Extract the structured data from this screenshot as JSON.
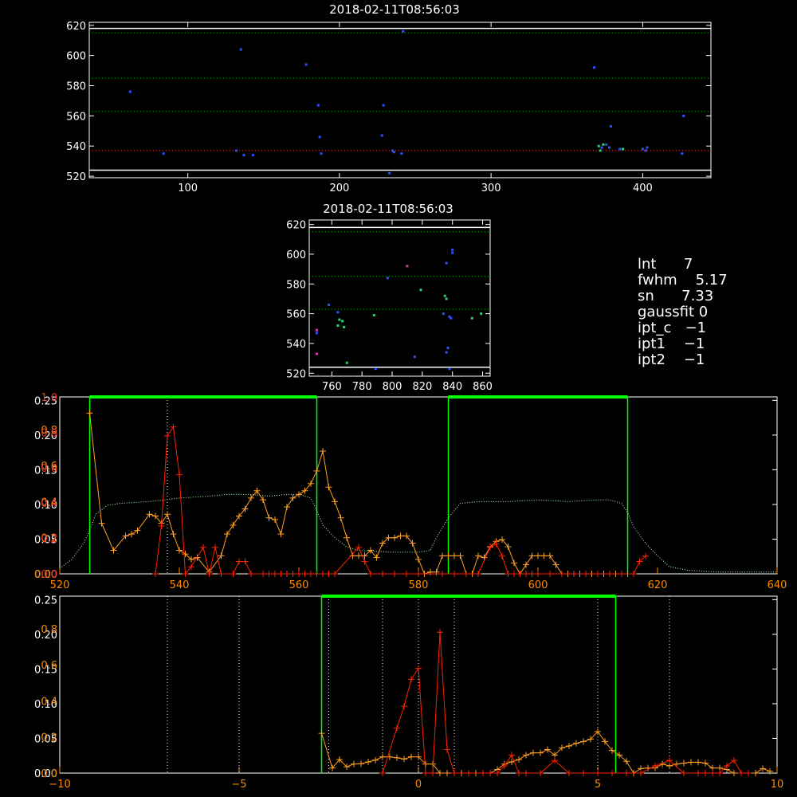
{
  "colors": {
    "axis_white": "#ffffff",
    "axis_orange": "#ff8c00",
    "axis_red": "#ff3020",
    "green": "#00ff00",
    "dotted_green": "#00c000",
    "orange_series": "#ffa020",
    "red_series": "#ff2000",
    "blue_points": "#3050ff",
    "green_points": "#30d070"
  },
  "info": {
    "rows": [
      {
        "key": "lnt",
        "value": "7"
      },
      {
        "key": "fwhm",
        "value": "5.17"
      },
      {
        "key": "sn",
        "value": "7.33"
      },
      {
        "key": "gaussfit",
        "value": "0"
      },
      {
        "key": "ipt_c",
        "value": "−1"
      },
      {
        "key": "ipt1",
        "value": "−1"
      },
      {
        "key": "ipt2",
        "value": "−1"
      }
    ]
  },
  "chart_data": [
    {
      "id": "top",
      "type": "scatter",
      "title": "2018-02-11T08:56:03",
      "xlim": [
        35,
        445
      ],
      "ylim": [
        519,
        622
      ],
      "xticks": [
        100,
        200,
        300,
        400
      ],
      "yticks": [
        520,
        540,
        560,
        580,
        600,
        620
      ],
      "hlines_solid": [
        618,
        524
      ],
      "hlines_dotted": [
        615,
        585,
        563
      ],
      "hline_red": 537,
      "points_blue": [
        [
          62,
          576
        ],
        [
          84,
          535
        ],
        [
          132,
          537
        ],
        [
          135,
          604
        ],
        [
          137,
          534
        ],
        [
          143,
          534
        ],
        [
          178,
          594
        ],
        [
          186,
          567
        ],
        [
          187,
          546
        ],
        [
          188,
          535
        ],
        [
          228,
          547
        ],
        [
          229,
          567
        ],
        [
          233,
          522
        ],
        [
          235,
          537
        ],
        [
          236,
          536
        ],
        [
          241,
          535
        ],
        [
          242,
          616
        ],
        [
          368,
          592
        ],
        [
          373,
          539
        ],
        [
          376,
          541
        ],
        [
          378,
          539
        ],
        [
          379,
          553
        ],
        [
          385,
          538
        ],
        [
          400,
          538
        ],
        [
          402,
          537
        ],
        [
          403,
          539
        ],
        [
          426,
          535
        ],
        [
          427,
          560
        ]
      ],
      "points_green": [
        [
          371,
          540
        ],
        [
          372,
          537
        ],
        [
          374,
          541
        ],
        [
          387,
          538
        ]
      ]
    },
    {
      "id": "middle",
      "type": "scatter",
      "title": "2018-02-11T08:56:03",
      "xlim": [
        745,
        865
      ],
      "ylim": [
        518,
        623
      ],
      "xticks": [
        760,
        780,
        800,
        820,
        840,
        860
      ],
      "yticks": [
        520,
        540,
        560,
        580,
        600,
        620
      ],
      "hlines_solid": [
        618,
        524
      ],
      "hlines_dotted": [
        615,
        585,
        563
      ],
      "points_blue": [
        [
          750,
          547
        ],
        [
          758,
          566
        ],
        [
          764,
          561
        ],
        [
          789,
          523
        ],
        [
          797,
          584
        ],
        [
          815,
          531
        ],
        [
          834,
          560
        ],
        [
          836,
          594
        ],
        [
          836,
          534
        ],
        [
          837,
          537
        ],
        [
          838,
          558
        ],
        [
          839,
          557
        ],
        [
          840,
          601
        ],
        [
          840,
          603
        ],
        [
          838,
          523
        ]
      ],
      "points_green": [
        [
          764,
          552
        ],
        [
          765,
          556
        ],
        [
          767,
          555
        ],
        [
          768,
          551
        ],
        [
          770,
          527
        ],
        [
          788,
          559
        ],
        [
          819,
          576
        ],
        [
          835,
          572
        ],
        [
          836,
          570
        ],
        [
          853,
          557
        ],
        [
          859,
          560
        ]
      ],
      "points_magenta": [
        [
          750,
          533
        ],
        [
          750,
          549
        ],
        [
          810,
          592
        ]
      ]
    },
    {
      "id": "spectrum",
      "type": "line",
      "xlim": [
        520,
        640
      ],
      "xticks": [
        520,
        540,
        560,
        580,
        600,
        620,
        640
      ],
      "yticks_left_white": [
        "0.00",
        "0.05",
        "0.10",
        "0.15",
        "0.20",
        "0.25"
      ],
      "yticks_left_orange": [
        "0.00",
        "0.2",
        "0.4",
        "0.6",
        "0.8"
      ],
      "yticks_left_red": [
        "0.0",
        "0.2",
        "0.4",
        "0.6",
        "0.8",
        "1.0"
      ],
      "green_box_ranges": [
        [
          525,
          563
        ],
        [
          585,
          615
        ]
      ],
      "vline_dotted": [
        538
      ],
      "orange_series": {
        "x": [
          525,
          527,
          529,
          531,
          532,
          533,
          535,
          536,
          537,
          538,
          539,
          540,
          541,
          542,
          543,
          545,
          547,
          548,
          549,
          550,
          551,
          552,
          553,
          554,
          555,
          556,
          557,
          558,
          559,
          560,
          561,
          562,
          563,
          564,
          565,
          566,
          567,
          568,
          569,
          570,
          571,
          572,
          573,
          574,
          575,
          576,
          577,
          578,
          579,
          580,
          581,
          582,
          583,
          584,
          585,
          586,
          587,
          588,
          589,
          590,
          591,
          592,
          593,
          594,
          595,
          596,
          597,
          598,
          599,
          600,
          601,
          602,
          603,
          604,
          605,
          606,
          607,
          608,
          609,
          610,
          611,
          612,
          613,
          614,
          615
        ],
        "y": [
          0.89,
          0.28,
          0.13,
          0.21,
          0.22,
          0.24,
          0.33,
          0.32,
          0.28,
          0.33,
          0.22,
          0.13,
          0.11,
          0.08,
          0.09,
          0.01,
          0.1,
          0.22,
          0.27,
          0.32,
          0.36,
          0.42,
          0.46,
          0.41,
          0.31,
          0.3,
          0.22,
          0.37,
          0.42,
          0.44,
          0.46,
          0.5,
          0.57,
          0.68,
          0.48,
          0.4,
          0.31,
          0.2,
          0.1,
          0.1,
          0.1,
          0.13,
          0.09,
          0.17,
          0.2,
          0.2,
          0.21,
          0.21,
          0.17,
          0.08,
          0.0,
          0.01,
          0.01,
          0.1,
          0.1,
          0.1,
          0.1,
          0.0,
          0.0,
          0.1,
          0.09,
          0.15,
          0.18,
          0.19,
          0.15,
          0.06,
          0.0,
          0.05,
          0.1,
          0.1,
          0.1,
          0.1,
          0.05,
          0.0,
          0.0,
          0.0,
          0.0,
          0.0,
          0.0,
          0.0,
          0.0,
          0.0,
          0.0,
          0.0,
          0.0
        ]
      },
      "red_series": {
        "x": [
          536,
          537,
          538,
          539,
          540,
          541,
          542,
          544,
          545,
          546,
          547,
          549,
          550,
          551,
          552,
          554,
          555,
          556,
          557,
          558,
          559,
          560,
          561,
          562,
          563,
          564,
          565,
          566,
          570,
          571,
          572,
          574,
          576,
          578,
          580,
          584,
          586,
          588,
          590,
          592,
          593,
          594,
          595,
          596,
          597,
          598,
          599,
          600,
          602,
          604,
          606,
          608,
          610,
          612,
          614,
          616,
          617,
          618
        ],
        "y": [
          0.0,
          0.27,
          0.78,
          0.83,
          0.56,
          0.0,
          0.04,
          0.15,
          0.0,
          0.15,
          0.0,
          0.0,
          0.07,
          0.07,
          0.0,
          0.0,
          0.0,
          0.0,
          0.0,
          0.0,
          0.0,
          0.0,
          0.0,
          0.0,
          0.0,
          0.0,
          0.0,
          0.0,
          0.15,
          0.07,
          0.0,
          0.0,
          0.0,
          0.0,
          0.0,
          0.0,
          0.0,
          0.0,
          0.0,
          0.15,
          0.17,
          0.1,
          0.0,
          0.0,
          0.0,
          0.0,
          0.0,
          0.0,
          0.0,
          0.0,
          0.0,
          0.0,
          0.0,
          0.0,
          0.0,
          0.0,
          0.07,
          0.1
        ]
      },
      "dotted_green_curve": {
        "x": [
          520,
          522,
          524,
          525,
          526,
          528,
          530,
          535,
          540,
          545,
          548,
          550,
          552,
          555,
          558,
          560,
          562,
          563,
          564,
          566,
          568,
          570,
          575,
          580,
          582,
          583,
          585,
          587,
          590,
          595,
          600,
          605,
          610,
          612,
          614,
          615,
          616,
          618,
          620,
          622,
          625,
          630,
          635,
          640
        ],
        "y": [
          0.03,
          0.08,
          0.17,
          0.24,
          0.33,
          0.38,
          0.39,
          0.4,
          0.42,
          0.43,
          0.44,
          0.44,
          0.44,
          0.43,
          0.44,
          0.44,
          0.42,
          0.35,
          0.27,
          0.2,
          0.15,
          0.13,
          0.12,
          0.12,
          0.13,
          0.2,
          0.31,
          0.39,
          0.4,
          0.4,
          0.41,
          0.4,
          0.41,
          0.41,
          0.39,
          0.34,
          0.26,
          0.17,
          0.1,
          0.04,
          0.02,
          0.01,
          0.01,
          0.01
        ]
      }
    },
    {
      "id": "velocity",
      "type": "line",
      "xlim": [
        -10,
        10
      ],
      "xticks": [
        -10,
        -5,
        0,
        5,
        10
      ],
      "yticks_left_white": [
        "0.00",
        "0.05",
        "0.10",
        "0.15",
        "0.20",
        "0.25"
      ],
      "yticks_left_orange": [
        "0.0",
        "0.2",
        "0.4",
        "0.6",
        "0.8"
      ],
      "green_box_range": [
        -2.7,
        5.5
      ],
      "vlines_dotted": [
        -7,
        -5,
        -2.5,
        -1,
        0,
        1,
        5,
        7
      ],
      "orange_series": {
        "x": [
          -2.7,
          -2.4,
          -2.2,
          -2.0,
          -1.8,
          -1.6,
          -1.4,
          -1.2,
          -1.0,
          -0.8,
          -0.6,
          -0.4,
          -0.2,
          0.0,
          0.2,
          0.4,
          0.6,
          0.8,
          1.0,
          1.2,
          1.4,
          1.6,
          1.8,
          2.0,
          2.2,
          2.4,
          2.6,
          2.8,
          3.0,
          3.2,
          3.4,
          3.6,
          3.8,
          4.0,
          4.2,
          4.4,
          4.6,
          4.8,
          5.0,
          5.2,
          5.4,
          5.6,
          5.8,
          6.0,
          6.2,
          6.4,
          6.6,
          6.8,
          7.0,
          7.2,
          7.4,
          7.6,
          7.8,
          8.0,
          8.2,
          8.4,
          8.6,
          8.8,
          9.0,
          9.2,
          9.4,
          9.6,
          9.8
        ],
        "y": [
          0.22,
          0.028,
          0.075,
          0.035,
          0.05,
          0.052,
          0.062,
          0.072,
          0.09,
          0.09,
          0.085,
          0.078,
          0.09,
          0.09,
          0.05,
          0.05,
          0.0,
          0.0,
          0.0,
          0.0,
          0.0,
          0.0,
          0.0,
          0.0,
          0.02,
          0.05,
          0.062,
          0.075,
          0.1,
          0.112,
          0.112,
          0.13,
          0.1,
          0.14,
          0.15,
          0.165,
          0.175,
          0.188,
          0.23,
          0.175,
          0.125,
          0.1,
          0.065,
          0.0,
          0.025,
          0.028,
          0.028,
          0.05,
          0.04,
          0.05,
          0.055,
          0.06,
          0.06,
          0.055,
          0.028,
          0.028,
          0.02,
          0.0,
          0.0,
          0.0,
          0.0,
          0.025,
          0.01
        ]
      },
      "red_series": {
        "x": [
          -1.0,
          -0.6,
          -0.4,
          -0.2,
          0.0,
          0.2,
          0.4,
          0.6,
          0.8,
          1.0,
          1.4,
          1.8,
          2.0,
          2.2,
          2.4,
          2.6,
          2.8,
          3.0,
          3.4,
          3.8,
          4.2,
          4.6,
          5.0,
          5.4,
          5.8,
          6.2,
          6.6,
          7.0,
          7.4,
          7.8,
          8.0,
          8.2,
          8.4,
          8.6,
          8.8,
          9.0,
          9.2
        ],
        "y": [
          0.0,
          0.25,
          0.37,
          0.52,
          0.58,
          0.0,
          0.0,
          0.78,
          0.13,
          0.0,
          0.0,
          0.0,
          0.0,
          0.0,
          0.04,
          0.1,
          0.0,
          0.0,
          0.0,
          0.07,
          0.0,
          0.0,
          0.0,
          0.0,
          0.0,
          0.0,
          0.04,
          0.07,
          0.0,
          0.0,
          0.0,
          0.0,
          0.0,
          0.04,
          0.07,
          0.0,
          0.0
        ]
      }
    }
  ]
}
